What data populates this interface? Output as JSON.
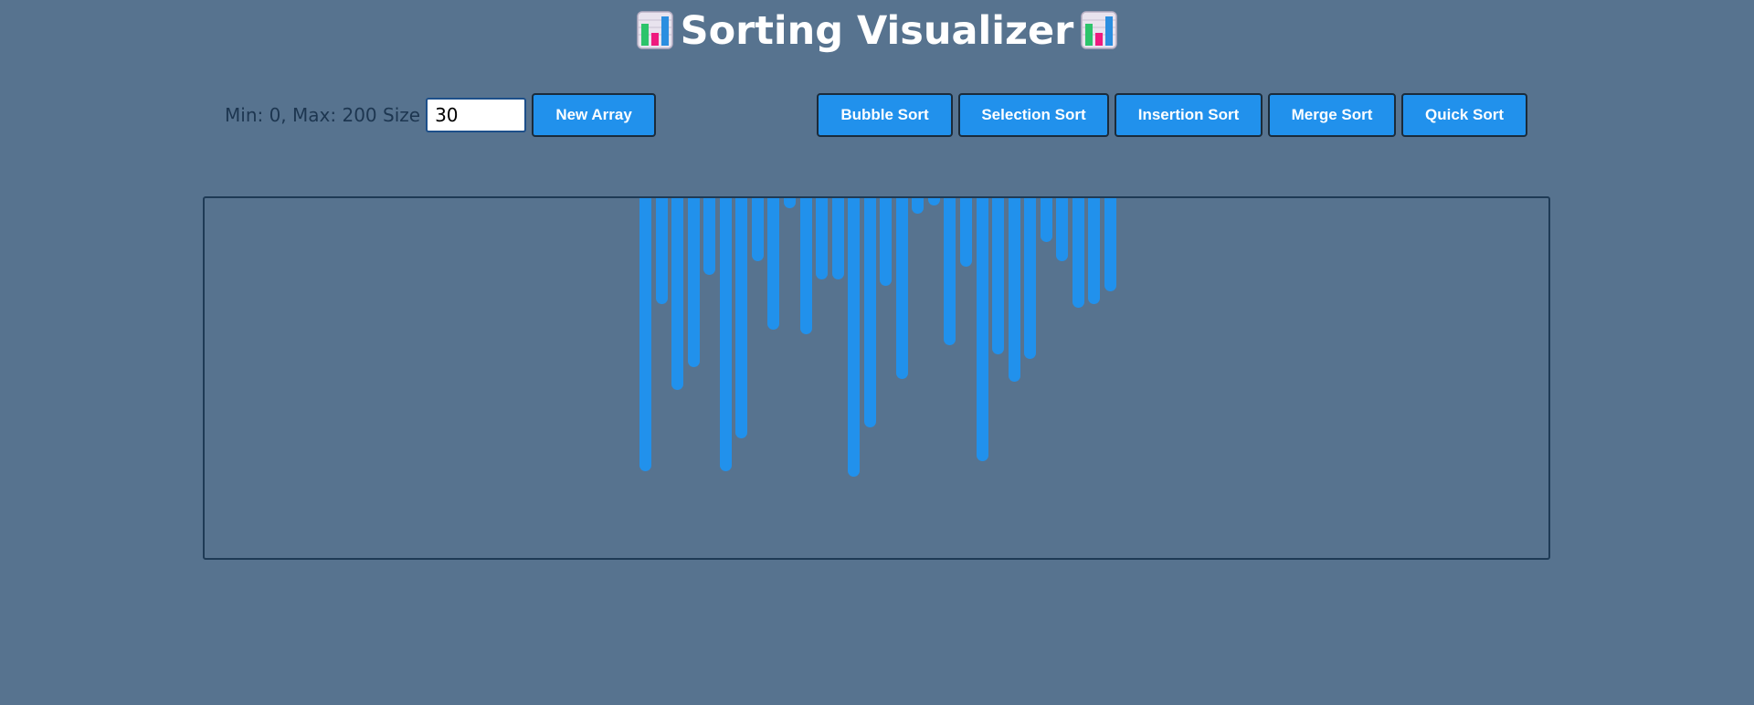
{
  "header": {
    "title": "Sorting Visualizer",
    "icon": "bar-chart-emoji"
  },
  "controls": {
    "range_label": "Min: 0, Max: 200 Size",
    "size_value": "30",
    "new_array_label": "New Array",
    "sort_buttons": [
      {
        "label": "Bubble Sort"
      },
      {
        "label": "Selection Sort"
      },
      {
        "label": "Insertion Sort"
      },
      {
        "label": "Merge Sort"
      },
      {
        "label": "Quick Sort"
      }
    ]
  },
  "colors": {
    "background": "#57738f",
    "bar": "#2191ec",
    "button": "#2191ec"
  },
  "array": {
    "max": 200,
    "values": [
      199,
      77,
      140,
      123,
      56,
      199,
      175,
      46,
      96,
      7,
      99,
      59,
      59,
      203,
      167,
      64,
      132,
      11,
      5,
      107,
      50,
      192,
      114,
      134,
      117,
      32,
      46,
      80,
      77,
      68
    ]
  }
}
